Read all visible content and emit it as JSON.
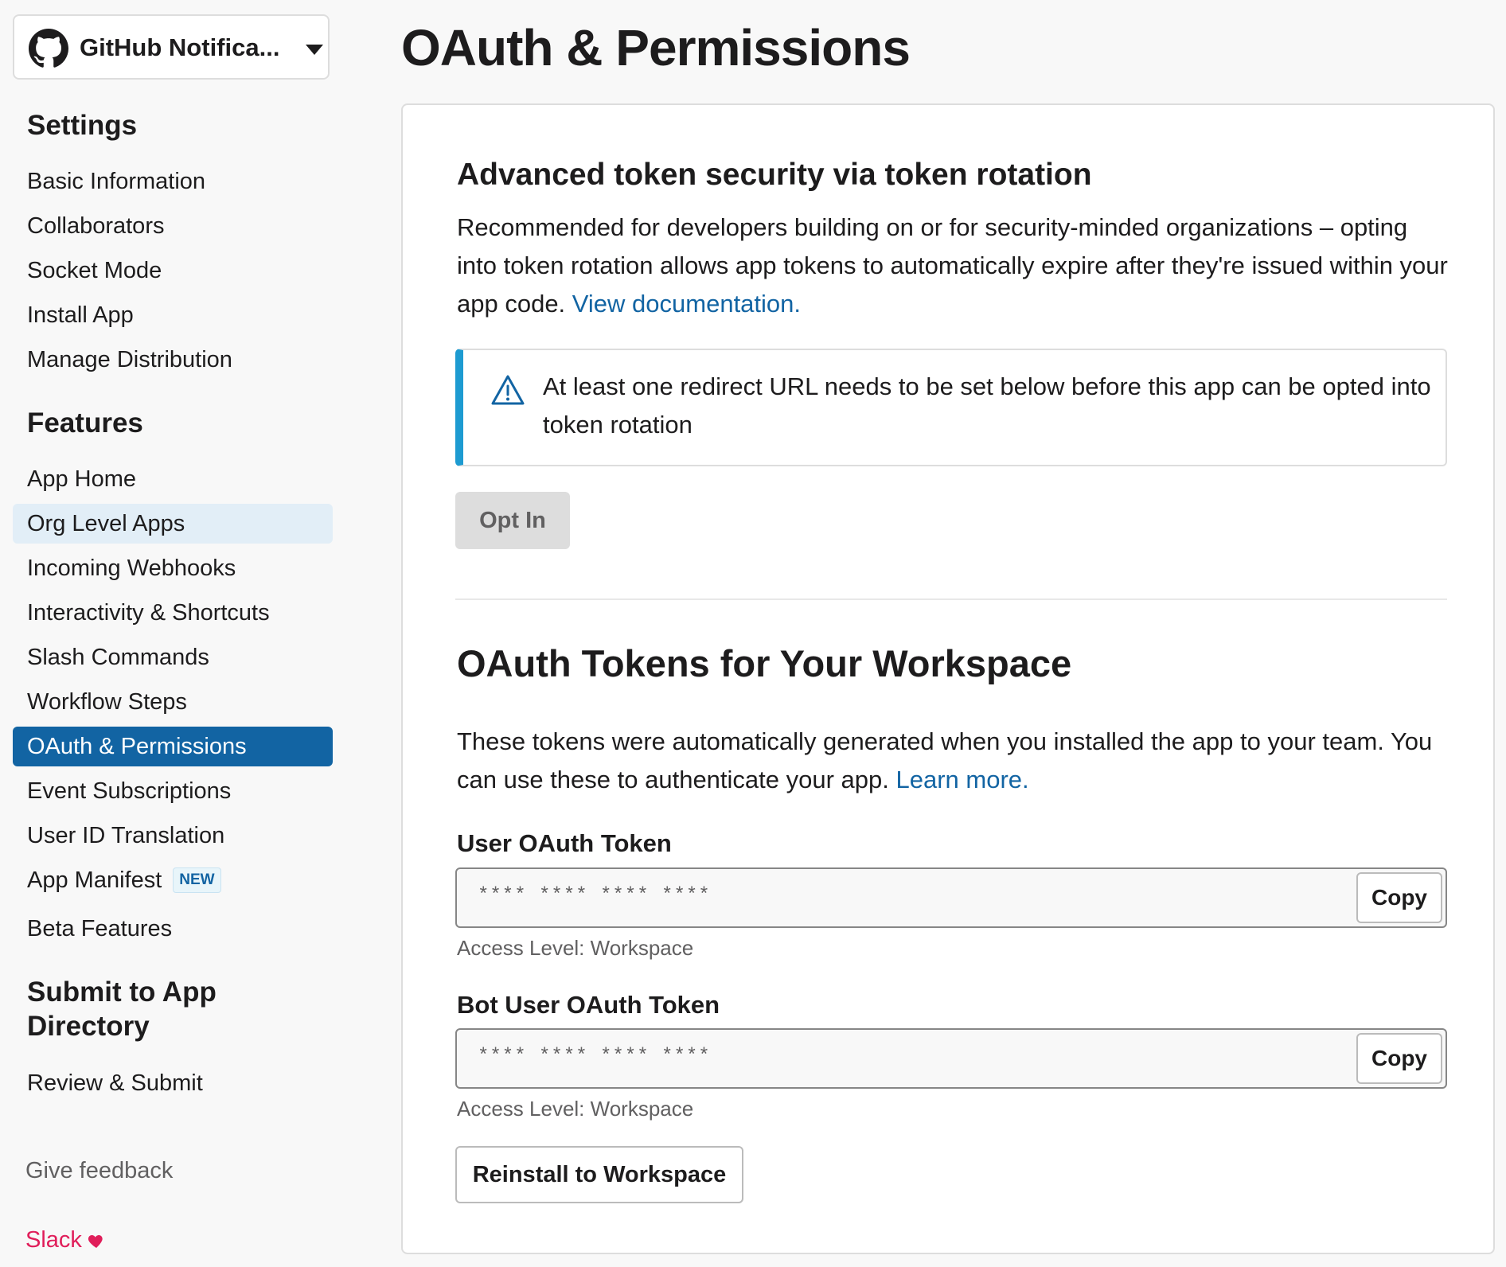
{
  "app_switcher": {
    "name": "GitHub Notifica...",
    "icon": "github-icon"
  },
  "sidebar": {
    "settings_heading": "Settings",
    "settings_items": [
      "Basic Information",
      "Collaborators",
      "Socket Mode",
      "Install App",
      "Manage Distribution"
    ],
    "features_heading": "Features",
    "features_items": [
      "App Home",
      "Org Level Apps",
      "Incoming Webhooks",
      "Interactivity & Shortcuts",
      "Slash Commands",
      "Workflow Steps",
      "OAuth & Permissions",
      "Event Subscriptions",
      "User ID Translation",
      "App Manifest",
      "Beta Features"
    ],
    "new_badge": "NEW",
    "submit_heading_line1": "Submit to App",
    "submit_heading_line2": "Directory",
    "submit_items": [
      "Review & Submit"
    ],
    "hovered_item": "Org Level Apps",
    "active_item": "OAuth & Permissions",
    "feedback": "Give feedback",
    "brand": "Slack"
  },
  "page": {
    "title": "OAuth & Permissions"
  },
  "token_rotation": {
    "title": "Advanced token security via token rotation",
    "description": "Recommended for developers building on or for security-minded organizations – opting into token rotation allows app tokens to automatically expire after they're issued within your app code.",
    "doc_link": "View documentation.",
    "alert_text": "At least one redirect URL needs to be set below before this app can be opted into token rotation",
    "opt_in_label": "Opt In"
  },
  "oauth_tokens": {
    "title": "OAuth Tokens for Your Workspace",
    "description": "These tokens were automatically generated when you installed the app to your team. You can use these to authenticate your app.",
    "learn_more": "Learn more.",
    "user_token": {
      "label": "User OAuth Token",
      "value": "**** **** **** ****",
      "copy_label": "Copy",
      "access_level": "Access Level: Workspace"
    },
    "bot_token": {
      "label": "Bot User OAuth Token",
      "value": "**** **** **** ****",
      "copy_label": "Copy",
      "access_level": "Access Level: Workspace"
    },
    "reinstall_label": "Reinstall to Workspace"
  },
  "colors": {
    "active_bg": "#1264a3",
    "hover_bg": "#e2eef7",
    "link": "#1264a3",
    "alert_accent": "#1d9bd1",
    "brand": "#e01e5a"
  }
}
